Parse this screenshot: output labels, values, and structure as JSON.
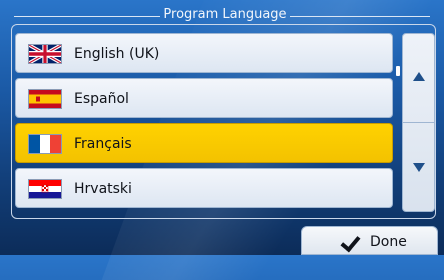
{
  "window": {
    "title": "Program Language"
  },
  "languages": [
    {
      "label": "English (UK)",
      "flag_icon": "uk-flag-icon",
      "selected": false
    },
    {
      "label": "Español",
      "flag_icon": "spain-flag-icon",
      "selected": false
    },
    {
      "label": "Français",
      "flag_icon": "france-flag-icon",
      "selected": true
    },
    {
      "label": "Hrvatski",
      "flag_icon": "croatia-flag-icon",
      "selected": false
    }
  ],
  "scrollbar": {
    "up_icon": "arrow-up-icon",
    "down_icon": "arrow-down-icon"
  },
  "footer": {
    "done_label": "Done",
    "done_icon": "checkmark-icon"
  },
  "colors": {
    "accent_selected": "#ffd200",
    "background": "#1b5aa6",
    "arrow": "#1f4f8a"
  }
}
